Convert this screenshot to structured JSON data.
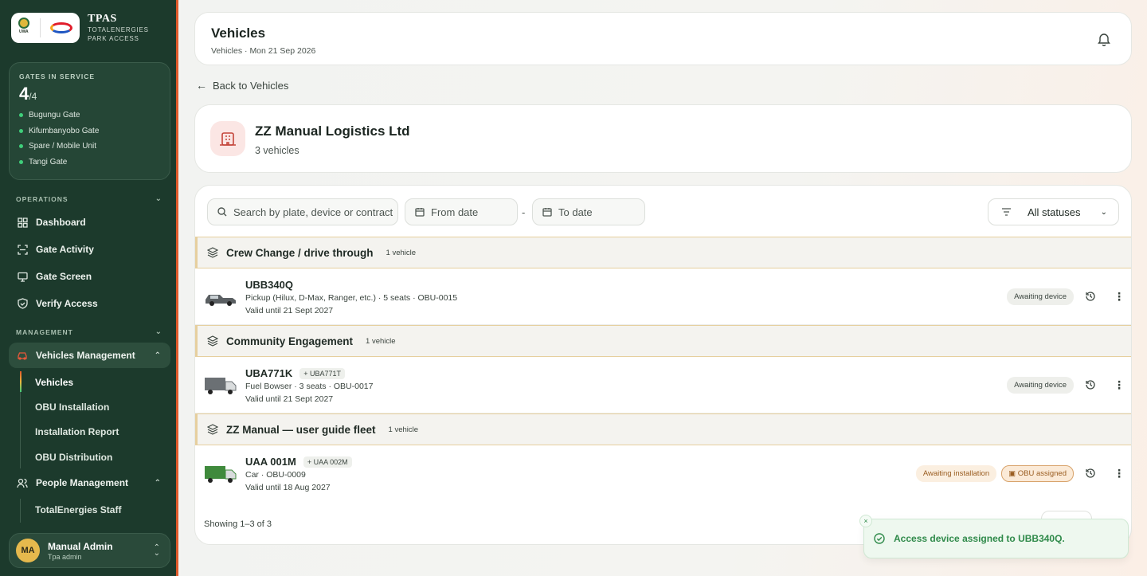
{
  "brand": {
    "title": "TPAS",
    "subtitle_line1": "TOTALENERGIES",
    "subtitle_line2": "PARK ACCESS",
    "logo_tag": "UWA"
  },
  "gates": {
    "label": "GATES IN SERVICE",
    "active": "4",
    "total": "/4",
    "items": [
      "Bugungu Gate",
      "Kifumbanyobo Gate",
      "Spare / Mobile Unit",
      "Tangi Gate"
    ]
  },
  "nav": {
    "operations_label": "OPERATIONS",
    "operations": [
      {
        "label": "Dashboard",
        "icon": "grid-icon"
      },
      {
        "label": "Gate Activity",
        "icon": "scan-icon"
      },
      {
        "label": "Gate Screen",
        "icon": "monitor-icon"
      },
      {
        "label": "Verify Access",
        "icon": "shield-check-icon"
      }
    ],
    "management_label": "MANAGEMENT",
    "vehicles_management": "Vehicles Management",
    "vehicles_sub": [
      "Vehicles",
      "OBU Installation",
      "Installation Report",
      "OBU Distribution"
    ],
    "people_management": "People Management",
    "people_sub": [
      "TotalEnergies Staff"
    ]
  },
  "user": {
    "initials": "MA",
    "name": "Manual Admin",
    "role": "Tpa admin"
  },
  "header": {
    "title": "Vehicles",
    "subtitle": "Vehicles · Mon 21 Sep 2026"
  },
  "back_label": "Back to Vehicles",
  "company": {
    "name": "ZZ Manual Logistics Ltd",
    "count": "3 vehicles"
  },
  "filters": {
    "search_placeholder": "Search by plate, device or contract",
    "from_placeholder": "From date",
    "to_placeholder": "To date",
    "dash": "-",
    "status": "All statuses"
  },
  "groups": [
    {
      "name": "Crew Change / drive through",
      "count": "1 vehicle",
      "vehicle": {
        "plate": "UBB340Q",
        "alt_plate": "",
        "meta": "Pickup (Hilux, D-Max, Ranger, etc.) · 5 seats · OBU-0015",
        "valid": "Valid until 21 Sept 2027",
        "badges": [
          "Awaiting device"
        ]
      }
    },
    {
      "name": "Community Engagement",
      "count": "1 vehicle",
      "vehicle": {
        "plate": "UBA771K",
        "alt_plate": "+ UBA771T",
        "meta": "Fuel Bowser · 3 seats · OBU-0017",
        "valid": "Valid until 21 Sept 2027",
        "badges": [
          "Awaiting device"
        ]
      }
    },
    {
      "name": "ZZ Manual — user guide fleet",
      "count": "1 vehicle",
      "vehicle": {
        "plate": "UAA 001M",
        "alt_plate": "+ UAA 002M",
        "meta": "Car · OBU-0009",
        "valid": "Valid until 18 Aug 2027",
        "badges": [
          "Awaiting installation",
          "OBU assigned"
        ]
      }
    }
  ],
  "showing": "Showing 1–3 of 3",
  "toast": {
    "message": "Access device assigned to UBB340Q.",
    "close": "×"
  }
}
